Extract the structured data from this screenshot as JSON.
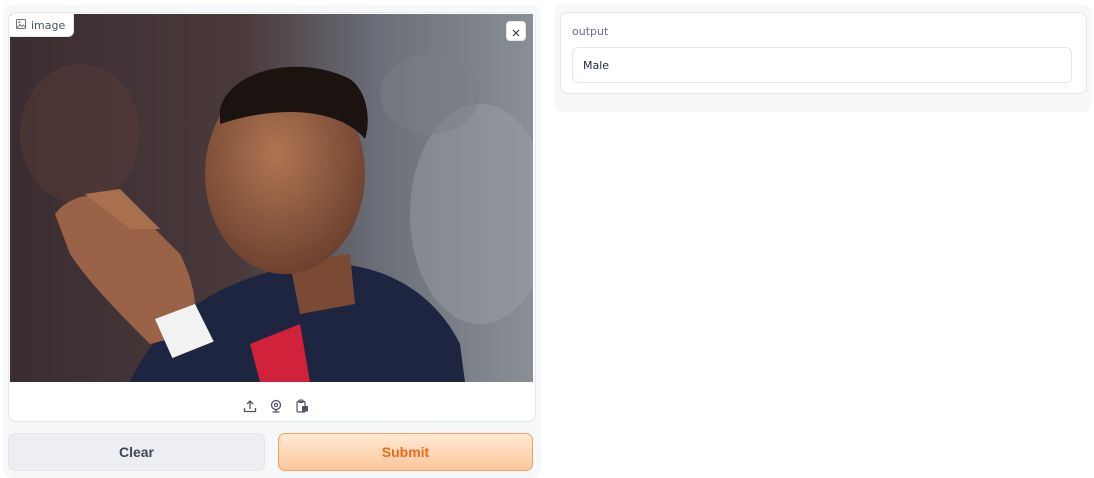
{
  "input_image": {
    "label": "image",
    "label_icon": "image-icon",
    "close_icon": "close-icon",
    "toolbar_icons": [
      "upload-icon",
      "webcam-icon",
      "clipboard-icon"
    ]
  },
  "buttons": {
    "clear_label": "Clear",
    "submit_label": "Submit"
  },
  "output": {
    "label": "output",
    "value": "Male"
  },
  "colors": {
    "submit_text": "#ea6a1c",
    "submit_border": "#f3a062",
    "panel_bg": "#f7f8fa"
  }
}
